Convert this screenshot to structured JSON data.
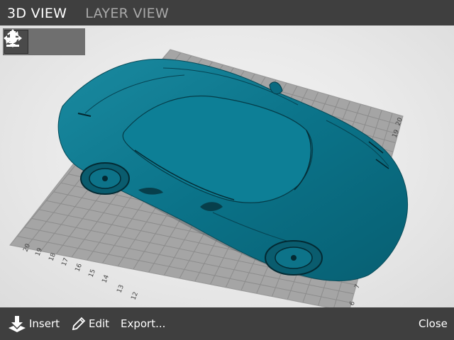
{
  "tabs": {
    "view_3d": "3D VIEW",
    "view_layer": "LAYER VIEW"
  },
  "toolbar": {
    "tools": [
      "rotate-icon",
      "move-icon",
      "drop-to-bed-icon"
    ],
    "selected": "rotate-icon"
  },
  "bed": {
    "left_axis_labels": [
      "20",
      "19",
      "18",
      "17",
      "16",
      "15",
      "14",
      "13",
      "12"
    ],
    "right_axis_labels": [
      "20",
      "19"
    ],
    "right_bottom_label": "6",
    "right_bottom_label2": "7"
  },
  "model": {
    "color": "#0b7389",
    "description_icon": "car-model"
  },
  "bottom": {
    "insert_label": "Insert",
    "edit_label": "Edit",
    "export_label": "Export...",
    "close_label": "Close"
  },
  "colors": {
    "bar": "#3f3f3f",
    "model": "#0b7389",
    "grid_bg": "#a3a3a3"
  }
}
